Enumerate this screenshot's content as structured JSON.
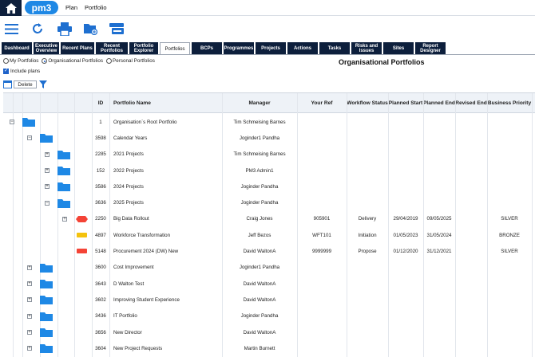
{
  "colors": {
    "navy": "#0d1f3c",
    "brand": "#1e88e5",
    "folder": "#1e88e5",
    "red": "#f44336",
    "yellow": "#f4c20d"
  },
  "topbar": {
    "logo": "pm3",
    "nav": [
      "Plan",
      "Portfolio"
    ]
  },
  "toolbar": {
    "icons": [
      "menu-icon",
      "refresh-icon",
      "print-icon",
      "new-folder-icon",
      "drive-icon"
    ]
  },
  "tabs": [
    {
      "label": "Dashboard"
    },
    {
      "label": "Executive Overview"
    },
    {
      "label": "Recent Plans"
    },
    {
      "label": "Recent Portfolios"
    },
    {
      "label": "Portfolio Explorer"
    },
    {
      "label": "Portfolios",
      "active": true
    },
    {
      "label": "BCPs"
    },
    {
      "label": "Programmes"
    },
    {
      "label": "Projects"
    },
    {
      "label": "Actions"
    },
    {
      "label": "Tasks"
    },
    {
      "label": "Risks and Issues"
    },
    {
      "label": "Sites"
    },
    {
      "label": "Report Designer"
    }
  ],
  "filters": {
    "options": [
      {
        "label": "My Portfolios",
        "selected": false
      },
      {
        "label": "Organisational Portfolios",
        "selected": true
      },
      {
        "label": "Personal Portfolios",
        "selected": false
      }
    ],
    "include_plans": {
      "label": "Include plans",
      "checked": true
    }
  },
  "page_title": "Organisational Portfolios",
  "actions": {
    "delete_label": "Delete"
  },
  "columns": [
    "ID",
    "Portfolio Name",
    "Manager",
    "Your Ref",
    "Workflow Status",
    "Planned Start",
    "Planned End",
    "Revised End",
    "Business Priority"
  ],
  "rows": [
    {
      "level": 0,
      "exp": "−",
      "icon": "folder",
      "id": "1",
      "name": "Organisation`s Root Portfolio",
      "manager": "Tim Schmeising Barnes",
      "ref": "",
      "status": "",
      "start": "",
      "end": "",
      "revised": "",
      "priority": ""
    },
    {
      "level": 1,
      "exp": "−",
      "icon": "folder",
      "id": "3598",
      "name": "Calendar Years",
      "manager": "Joginder1 Pandha",
      "ref": "",
      "status": "",
      "start": "",
      "end": "",
      "revised": "",
      "priority": ""
    },
    {
      "level": 2,
      "exp": "+",
      "icon": "folder",
      "id": "2285",
      "name": "2021 Projects",
      "manager": "Tim Schmeising Barnes",
      "ref": "",
      "status": "",
      "start": "",
      "end": "",
      "revised": "",
      "priority": ""
    },
    {
      "level": 2,
      "exp": "+",
      "icon": "folder",
      "id": "152",
      "name": "2022 Projects",
      "manager": "PM3 Admin1",
      "ref": "",
      "status": "",
      "start": "",
      "end": "",
      "revised": "",
      "priority": ""
    },
    {
      "level": 2,
      "exp": "+",
      "icon": "folder",
      "id": "3586",
      "name": "2024 Projects",
      "manager": "Joginder Pandha",
      "ref": "",
      "status": "",
      "start": "",
      "end": "",
      "revised": "",
      "priority": ""
    },
    {
      "level": 2,
      "exp": "−",
      "icon": "folder",
      "id": "3636",
      "name": "2025 Projects",
      "manager": "Joginder Pandha",
      "ref": "",
      "status": "",
      "start": "",
      "end": "",
      "revised": "",
      "priority": ""
    },
    {
      "level": 3,
      "exp": "+",
      "icon": "red-hex",
      "id": "2250",
      "name": "Big Data Rollout",
      "manager": "Craig Jones",
      "ref": "905901",
      "status": "Delivery",
      "start": "29/04/2019",
      "end": "09/05/2025",
      "revised": "",
      "priority": "SILVER"
    },
    {
      "level": 3,
      "exp": "",
      "icon": "yellow",
      "id": "4897",
      "name": "Workforce Transformation",
      "manager": "Jeff Bezos",
      "ref": "WFT101",
      "status": "Initiation",
      "start": "01/05/2023",
      "end": "31/05/2024",
      "revised": "",
      "priority": "BRONZE"
    },
    {
      "level": 3,
      "exp": "",
      "icon": "red",
      "id": "5148",
      "name": "Procurement 2024 (DW) New",
      "manager": "David WaltonA",
      "ref": "9999999",
      "status": "Propose",
      "start": "01/12/2020",
      "end": "31/12/2021",
      "revised": "",
      "priority": "SILVER"
    },
    {
      "level": 1,
      "exp": "+",
      "icon": "folder",
      "id": "3600",
      "name": "Cost Improvement",
      "manager": "Joginder1 Pandha",
      "ref": "",
      "status": "",
      "start": "",
      "end": "",
      "revised": "",
      "priority": ""
    },
    {
      "level": 1,
      "exp": "+",
      "icon": "folder",
      "id": "3643",
      "name": "D Walton Test",
      "manager": "David WaltonA",
      "ref": "",
      "status": "",
      "start": "",
      "end": "",
      "revised": "",
      "priority": ""
    },
    {
      "level": 1,
      "exp": "+",
      "icon": "folder",
      "id": "3602",
      "name": "Improving Student Experience",
      "manager": "David WaltonA",
      "ref": "",
      "status": "",
      "start": "",
      "end": "",
      "revised": "",
      "priority": ""
    },
    {
      "level": 1,
      "exp": "+",
      "icon": "folder",
      "id": "3436",
      "name": "IT Portfolio",
      "manager": "Joginder Pandha",
      "ref": "",
      "status": "",
      "start": "",
      "end": "",
      "revised": "",
      "priority": ""
    },
    {
      "level": 1,
      "exp": "+",
      "icon": "folder",
      "id": "3656",
      "name": "New Director",
      "manager": "David WaltonA",
      "ref": "",
      "status": "",
      "start": "",
      "end": "",
      "revised": "",
      "priority": ""
    },
    {
      "level": 1,
      "exp": "+",
      "icon": "folder",
      "id": "3604",
      "name": "New Project Requests",
      "manager": "Martin Burnett",
      "ref": "",
      "status": "",
      "start": "",
      "end": "",
      "revised": "",
      "priority": ""
    }
  ]
}
